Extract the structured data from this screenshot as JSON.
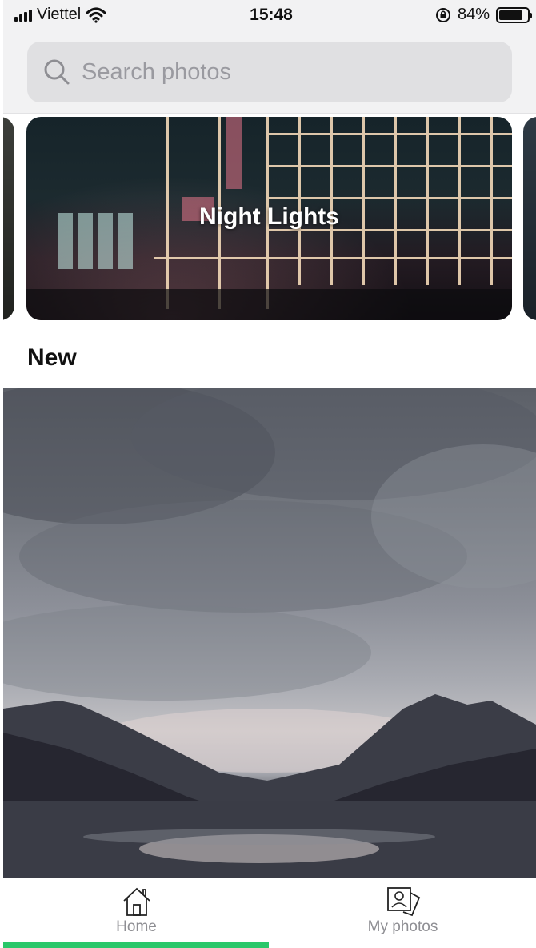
{
  "status_bar": {
    "carrier": "Viettel",
    "time": "15:48",
    "battery_percent": "84%",
    "battery_level": 0.84
  },
  "search": {
    "placeholder": "Search photos",
    "value": ""
  },
  "carousel": {
    "featured_title": "Night Lights"
  },
  "section": {
    "title": "New"
  },
  "tabs": [
    {
      "label": "Home",
      "icon": "home-icon",
      "active": true
    },
    {
      "label": "My photos",
      "icon": "photos-icon",
      "active": false
    }
  ],
  "colors": {
    "accent": "#2ac76a",
    "inactive_label": "#8e8e93"
  }
}
